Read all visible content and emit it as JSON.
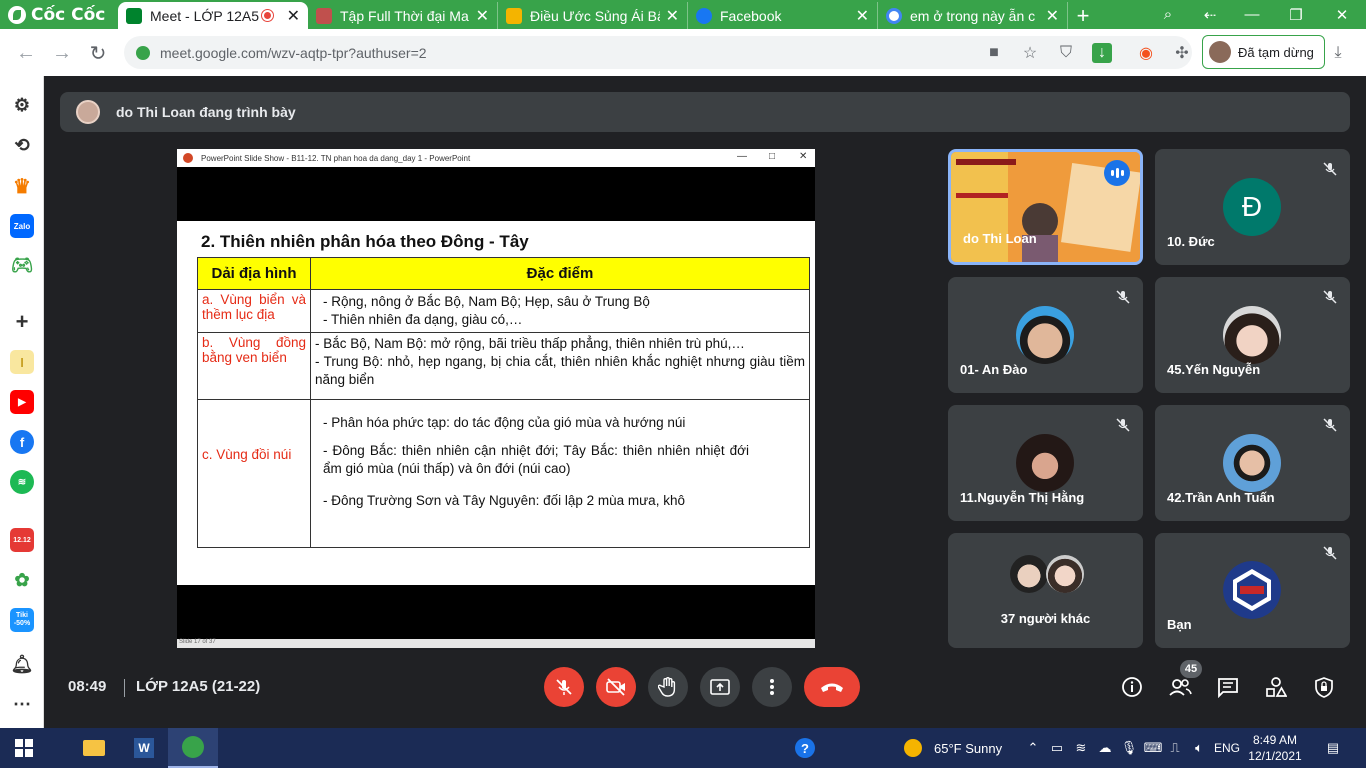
{
  "browser": {
    "brand": "Cốc Cốc",
    "tabs": [
      {
        "title": "Meet - LỚP 12A5",
        "active": true,
        "icon": "meet-icon"
      },
      {
        "title": "Tập Full Thời đại Ma",
        "active": false,
        "icon": "book-icon"
      },
      {
        "title": "Điều Ước Sủng Ái Bất",
        "active": false,
        "icon": "n-logo-icon"
      },
      {
        "title": "Facebook",
        "active": false,
        "icon": "facebook-icon"
      },
      {
        "title": "em ở trong này ẫn c",
        "active": false,
        "icon": "google-icon"
      }
    ],
    "url": "meet.google.com/wzv-aqtp-tpr?authuser=2",
    "profile_status": "Đã tạm dừng"
  },
  "meet": {
    "presenter_banner": "do Thi Loan đang trình bày",
    "time": "08:49",
    "meeting_name": "LỚP 12A5 (21-22)",
    "participant_count": "45",
    "tiles": [
      {
        "name": "do Thi Loan",
        "speaking": true
      },
      {
        "name": "10. Đức",
        "initial": "Đ",
        "avatar_color": "#00796b"
      },
      {
        "name": "01- An Đào"
      },
      {
        "name": "45.Yến Nguyễn"
      },
      {
        "name": "11.Nguyễn Thị Hằng"
      },
      {
        "name": "42.Trần Anh Tuấn"
      },
      {
        "name": "37 người khác"
      },
      {
        "name": "Bạn"
      }
    ]
  },
  "slide": {
    "window_title": "PowerPoint Slide Show  -  B11-12. TN phan hoa da dang_day 1 - PowerPoint",
    "status": "Slide 17 of 37",
    "heading": "2. Thiên nhiên phân hóa theo Đông - Tây",
    "col1": "Dải địa hình",
    "col2": "Đặc điểm",
    "rows": [
      {
        "label": "a. Vùng biển và thềm lục địa",
        "lines": [
          "- Rộng, nông ở Bắc Bộ, Nam Bộ; Hẹp, sâu ở Trung Bộ",
          "- Thiên nhiên đa dạng, giàu có,…"
        ]
      },
      {
        "label": "b. Vùng đồng bằng ven biển",
        "lines": [
          "- Bắc Bộ, Nam Bộ: mở rộng, bãi triều thấp phẳng, thiên nhiên trù phú,…",
          "- Trung Bộ: nhỏ, hẹp ngang, bị chia cắt, thiên nhiên khắc nghiệt nhưng giàu tiềm năng biển"
        ]
      },
      {
        "label": "c. Vùng đồi núi",
        "lines": [
          "- Phân hóa phức tạp: do tác động của gió mùa và hướng núi",
          "- Đông Bắc: thiên nhiên cận nhiệt đới; Tây Bắc: thiên nhiên nhiệt đới ẩm gió mùa (núi thấp) và ôn đới (núi cao)",
          "- Đông Trường Sơn và Tây Nguyên: đối lập 2 mùa mưa, khô"
        ]
      }
    ]
  },
  "sidebar": {
    "tiki_label": "Tiki",
    "tiki_discount": "-50%",
    "promo_date": "12.12"
  },
  "taskbar": {
    "weather": "65°F  Sunny",
    "lang": "ENG",
    "time": "8:49 AM",
    "date": "12/1/2021"
  }
}
